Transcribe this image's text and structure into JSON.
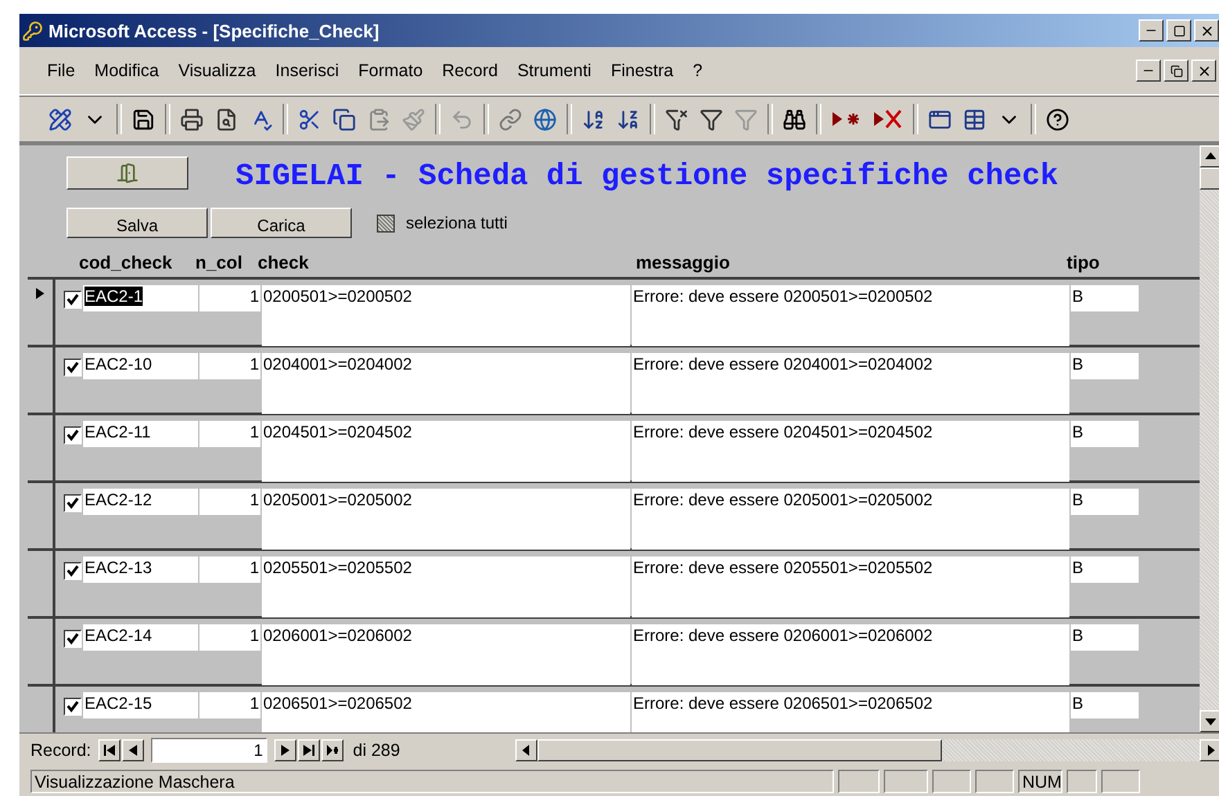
{
  "window": {
    "title": "Microsoft Access - [Specifiche_Check]"
  },
  "menu": [
    "File",
    "Modifica",
    "Visualizza",
    "Inserisci",
    "Formato",
    "Record",
    "Strumenti",
    "Finestra",
    "?"
  ],
  "form": {
    "title": "SIGELAI - Scheda di gestione specifiche check",
    "buttons": [
      "Salva",
      "Carica"
    ],
    "select_all": {
      "label": "seleziona tutti",
      "indeterminate": true
    },
    "columns": [
      "cod_check",
      "n_col",
      "check",
      "messaggio",
      "tipo"
    ],
    "rows": [
      {
        "selected": true,
        "checked": true,
        "cod_check": "EAC2-1",
        "n_col": "1",
        "check": "0200501>=0200502",
        "messaggio": "Errore: deve essere 0200501>=0200502",
        "tipo": "B"
      },
      {
        "selected": false,
        "checked": true,
        "cod_check": "EAC2-10",
        "n_col": "1",
        "check": "0204001>=0204002",
        "messaggio": "Errore: deve essere 0204001>=0204002",
        "tipo": "B"
      },
      {
        "selected": false,
        "checked": true,
        "cod_check": "EAC2-11",
        "n_col": "1",
        "check": "0204501>=0204502",
        "messaggio": "Errore: deve essere 0204501>=0204502",
        "tipo": "B"
      },
      {
        "selected": false,
        "checked": true,
        "cod_check": "EAC2-12",
        "n_col": "1",
        "check": "0205001>=0205002",
        "messaggio": "Errore: deve essere 0205001>=0205002",
        "tipo": "B"
      },
      {
        "selected": false,
        "checked": true,
        "cod_check": "EAC2-13",
        "n_col": "1",
        "check": "0205501>=0205502",
        "messaggio": "Errore: deve essere 0205501>=0205502",
        "tipo": "B"
      },
      {
        "selected": false,
        "checked": true,
        "cod_check": "EAC2-14",
        "n_col": "1",
        "check": "0206001>=0206002",
        "messaggio": "Errore: deve essere 0206001>=0206002",
        "tipo": "B"
      },
      {
        "selected": false,
        "checked": true,
        "cod_check": "EAC2-15",
        "n_col": "1",
        "check": "0206501>=0206502",
        "messaggio": "Errore: deve essere 0206501>=0206502",
        "tipo": "B"
      }
    ]
  },
  "navigation": {
    "label": "Record:",
    "current": "1",
    "total": "di 289"
  },
  "status_bar": {
    "text": "Visualizzazione Maschera",
    "indicator": "NUM"
  }
}
